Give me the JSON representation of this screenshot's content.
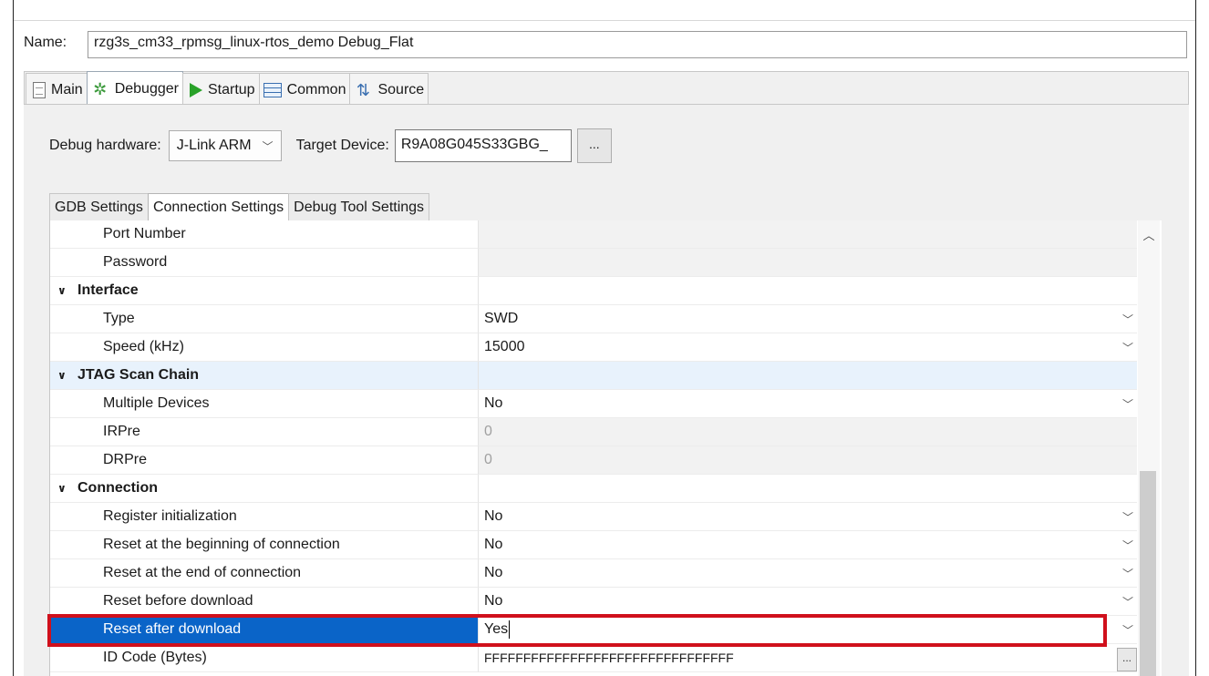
{
  "name": {
    "label": "Name:",
    "value": "rzg3s_cm33_rpmsg_linux-rtos_demo Debug_Flat"
  },
  "top_tabs": [
    {
      "label": "Main",
      "icon": "document-icon"
    },
    {
      "label": "Debugger",
      "icon": "bug-icon"
    },
    {
      "label": "Startup",
      "icon": "play-icon"
    },
    {
      "label": "Common",
      "icon": "common-icon"
    },
    {
      "label": "Source",
      "icon": "source-icon"
    }
  ],
  "debug_hardware": {
    "label": "Debug hardware:",
    "value": "J-Link ARM"
  },
  "target_device": {
    "label": "Target Device:",
    "value": "R9A08G045S33GBG_",
    "browse": "..."
  },
  "sub_tabs": [
    "GDB Settings",
    "Connection Settings",
    "Debug Tool Settings"
  ],
  "rows": [
    {
      "name": "Port Number",
      "value": ""
    },
    {
      "name": "Password",
      "value": ""
    },
    {
      "name": "Interface",
      "value": ""
    },
    {
      "name": "Type",
      "value": "SWD"
    },
    {
      "name": "Speed (kHz)",
      "value": "15000"
    },
    {
      "name": "JTAG Scan Chain",
      "value": ""
    },
    {
      "name": "Multiple Devices",
      "value": "No"
    },
    {
      "name": "IRPre",
      "value": "0"
    },
    {
      "name": "DRPre",
      "value": "0"
    },
    {
      "name": "Connection",
      "value": ""
    },
    {
      "name": "Register initialization",
      "value": "No"
    },
    {
      "name": "Reset at the beginning of connection",
      "value": "No"
    },
    {
      "name": "Reset at the end of connection",
      "value": "No"
    },
    {
      "name": "Reset before download",
      "value": "No"
    },
    {
      "name": "Reset after download",
      "value": "Yes"
    },
    {
      "name": "ID Code (Bytes)",
      "value": "FFFFFFFFFFFFFFFFFFFFFFFFFFFFFFFF"
    }
  ],
  "colors": {
    "selection": "#0a64c8",
    "highlight_box": "#d0101c",
    "group_tint": "#e8f2fc"
  }
}
